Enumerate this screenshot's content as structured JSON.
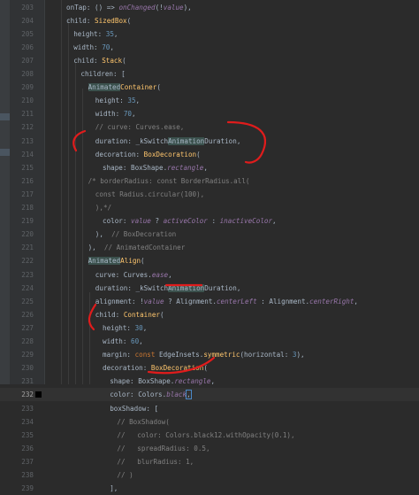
{
  "editor": {
    "language": "dart",
    "current_line": "232",
    "lines": [
      {
        "n": "203",
        "indent": 5,
        "tokens": [
          [
            "t",
            "onTap: () => "
          ],
          [
            "m",
            "onChanged"
          ],
          [
            "t",
            "(!"
          ],
          [
            "m",
            "value"
          ],
          [
            "t",
            "),"
          ]
        ]
      },
      {
        "n": "204",
        "indent": 5,
        "tokens": [
          [
            "t",
            "child: "
          ],
          [
            "c",
            "SizedBox"
          ],
          [
            "t",
            "("
          ]
        ]
      },
      {
        "n": "205",
        "indent": 6,
        "tokens": [
          [
            "t",
            "height: "
          ],
          [
            "n",
            "35"
          ],
          [
            "t",
            ","
          ]
        ]
      },
      {
        "n": "206",
        "indent": 6,
        "tokens": [
          [
            "t",
            "width: "
          ],
          [
            "n",
            "70"
          ],
          [
            "t",
            ","
          ]
        ]
      },
      {
        "n": "207",
        "indent": 6,
        "tokens": [
          [
            "t",
            "child: "
          ],
          [
            "c",
            "Stack"
          ],
          [
            "t",
            "("
          ]
        ]
      },
      {
        "n": "208",
        "indent": 7,
        "tokens": [
          [
            "t",
            "children: ["
          ]
        ]
      },
      {
        "n": "209",
        "indent": 8,
        "tokens": [
          [
            "h",
            "Animated"
          ],
          [
            "c",
            "Container"
          ],
          [
            "t",
            "("
          ]
        ]
      },
      {
        "n": "210",
        "indent": 9,
        "tokens": [
          [
            "t",
            "height: "
          ],
          [
            "n",
            "35"
          ],
          [
            "t",
            ","
          ]
        ]
      },
      {
        "n": "211",
        "indent": 9,
        "tokens": [
          [
            "t",
            "width: "
          ],
          [
            "n",
            "70"
          ],
          [
            "t",
            ","
          ]
        ]
      },
      {
        "n": "212",
        "indent": 9,
        "tokens": [
          [
            "g",
            "// curve: Curves.ease,"
          ]
        ]
      },
      {
        "n": "213",
        "indent": 9,
        "tokens": [
          [
            "t",
            "duration: _kSwitch"
          ],
          [
            "h",
            "Animation"
          ],
          [
            "t",
            "Duration,"
          ]
        ]
      },
      {
        "n": "214",
        "indent": 9,
        "tokens": [
          [
            "t",
            "decoration: "
          ],
          [
            "c",
            "BoxDecoration"
          ],
          [
            "t",
            "("
          ]
        ]
      },
      {
        "n": "215",
        "indent": 10,
        "tokens": [
          [
            "t",
            "shape: BoxShape."
          ],
          [
            "m",
            "rectangle"
          ],
          [
            "t",
            ","
          ]
        ]
      },
      {
        "n": "216",
        "indent": 8,
        "tokens": [
          [
            "g",
            "/* borderRadius: const BorderRadius.all("
          ]
        ]
      },
      {
        "n": "217",
        "indent": 9,
        "tokens": [
          [
            "g",
            "const Radius.circular(100),"
          ]
        ]
      },
      {
        "n": "218",
        "indent": 9,
        "tokens": [
          [
            "g",
            "),*/"
          ]
        ]
      },
      {
        "n": "219",
        "indent": 10,
        "tokens": [
          [
            "t",
            "color: "
          ],
          [
            "m",
            "value"
          ],
          [
            "t",
            " ? "
          ],
          [
            "m",
            "activeColor"
          ],
          [
            "t",
            " : "
          ],
          [
            "m",
            "inactiveColor"
          ],
          [
            "t",
            ","
          ]
        ]
      },
      {
        "n": "220",
        "indent": 9,
        "tokens": [
          [
            "t",
            "),  "
          ],
          [
            "g",
            "// BoxDecoration"
          ]
        ]
      },
      {
        "n": "221",
        "indent": 8,
        "tokens": [
          [
            "t",
            "),  "
          ],
          [
            "g",
            "// AnimatedContainer"
          ]
        ]
      },
      {
        "n": "222",
        "indent": 8,
        "tokens": [
          [
            "h",
            "Animated"
          ],
          [
            "c",
            "Align"
          ],
          [
            "t",
            "("
          ]
        ]
      },
      {
        "n": "223",
        "indent": 9,
        "tokens": [
          [
            "t",
            "curve: Curves."
          ],
          [
            "m",
            "ease"
          ],
          [
            "t",
            ","
          ]
        ]
      },
      {
        "n": "224",
        "indent": 9,
        "tokens": [
          [
            "t",
            "duration: _kSwitch"
          ],
          [
            "h",
            "Animation"
          ],
          [
            "t",
            "Duration,"
          ]
        ]
      },
      {
        "n": "225",
        "indent": 9,
        "tokens": [
          [
            "t",
            "alignment: !"
          ],
          [
            "m",
            "value"
          ],
          [
            "t",
            " ? Alignment."
          ],
          [
            "m",
            "centerLeft"
          ],
          [
            "t",
            " : Alignment."
          ],
          [
            "m",
            "centerRight"
          ],
          [
            "t",
            ","
          ]
        ]
      },
      {
        "n": "226",
        "indent": 9,
        "tokens": [
          [
            "t",
            "child: "
          ],
          [
            "c",
            "Container"
          ],
          [
            "t",
            "("
          ]
        ]
      },
      {
        "n": "227",
        "indent": 10,
        "tokens": [
          [
            "t",
            "height: "
          ],
          [
            "n",
            "30"
          ],
          [
            "t",
            ","
          ]
        ]
      },
      {
        "n": "228",
        "indent": 10,
        "tokens": [
          [
            "t",
            "width: "
          ],
          [
            "n",
            "60"
          ],
          [
            "t",
            ","
          ]
        ]
      },
      {
        "n": "229",
        "indent": 10,
        "tokens": [
          [
            "t",
            "margin: "
          ],
          [
            "k",
            "const "
          ],
          [
            "t",
            "EdgeInsets."
          ],
          [
            "c",
            "symmetric"
          ],
          [
            "t",
            "(horizontal: "
          ],
          [
            "n",
            "3"
          ],
          [
            "t",
            "),"
          ]
        ]
      },
      {
        "n": "230",
        "indent": 10,
        "tokens": [
          [
            "t",
            "decoration: "
          ],
          [
            "c",
            "BoxDecoration"
          ],
          [
            "t",
            "("
          ]
        ]
      },
      {
        "n": "231",
        "indent": 11,
        "tokens": [
          [
            "t",
            "shape: BoxShape."
          ],
          [
            "m",
            "rectangle"
          ],
          [
            "t",
            ","
          ]
        ]
      },
      {
        "n": "232",
        "indent": 11,
        "tokens": [
          [
            "t",
            "color: Colors."
          ],
          [
            "m",
            "black"
          ],
          [
            "x",
            ","
          ]
        ]
      },
      {
        "n": "233",
        "indent": 11,
        "tokens": [
          [
            "t",
            "boxShadow: ["
          ]
        ]
      },
      {
        "n": "234",
        "indent": 12,
        "tokens": [
          [
            "g",
            "// BoxShadow("
          ]
        ]
      },
      {
        "n": "235",
        "indent": 12,
        "tokens": [
          [
            "g",
            "//   color: Colors.black12.withOpacity(0.1),"
          ]
        ]
      },
      {
        "n": "236",
        "indent": 12,
        "tokens": [
          [
            "g",
            "//   spreadRadius: 0.5,"
          ]
        ]
      },
      {
        "n": "237",
        "indent": 12,
        "tokens": [
          [
            "g",
            "//   blurRadius: 1,"
          ]
        ]
      },
      {
        "n": "238",
        "indent": 12,
        "tokens": [
          [
            "g",
            "// )"
          ]
        ]
      },
      {
        "n": "239",
        "indent": 11,
        "tokens": [
          [
            "t",
            "],"
          ]
        ]
      }
    ]
  },
  "colors": {
    "background": "#2b2b2b",
    "gutter": "#313335",
    "annotation": "#e01c1c"
  }
}
